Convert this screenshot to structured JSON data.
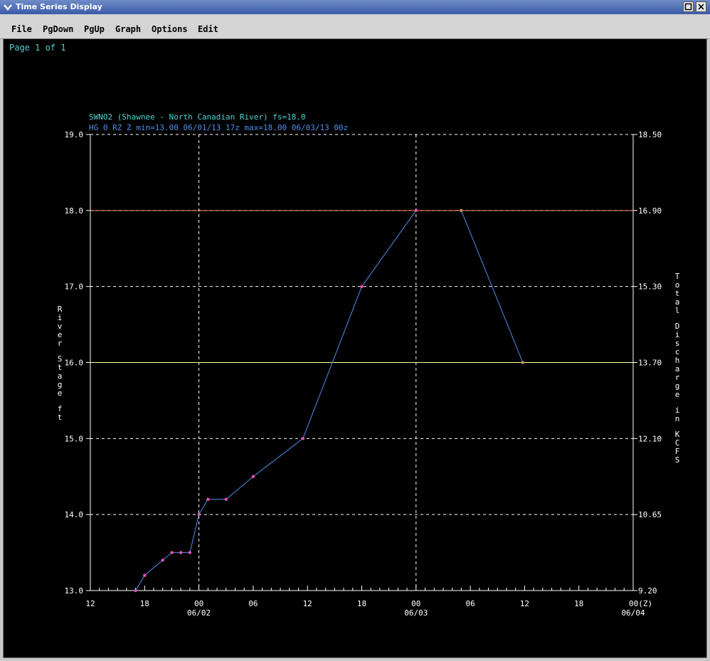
{
  "window": {
    "title": "Time Series Display"
  },
  "menu": [
    "File",
    "PgDown",
    "PgUp",
    "Graph",
    "Options",
    "Edit"
  ],
  "page_info": "Page 1 of 1",
  "colors": {
    "window_bg": "#000000",
    "grid": "#ffffff",
    "series_line": "#4f8fe8",
    "point": "#e84fb8",
    "forecast_point": "#c8904f",
    "flood_stage": "#ff8a6a",
    "action_stage": "#ffff99",
    "title_cyan": "#4fd2d2",
    "title_blue": "#4f8fe8"
  },
  "chart_data": {
    "type": "line",
    "title": "SWNO2 (Shawnee - North Canadian River) fs=18.0",
    "subtitle": "HG 0 RZ Z min=13.00 06/01/13 17z max=18.00 06/03/13 00z",
    "ylabel": "River Stage ft",
    "ylabel_right": "Total Discharge in KCFS",
    "ylim": [
      13.0,
      19.0
    ],
    "yticks": [
      "13.0",
      "14.0",
      "15.0",
      "16.0",
      "17.0",
      "18.0",
      "19.0"
    ],
    "yticks_right": [
      "9.20",
      "10.65",
      "12.10",
      "13.70",
      "15.30",
      "16.90",
      "18.50"
    ],
    "x_unit": "hours",
    "x_range": [
      "06/01 12Z",
      "06/04 00Z"
    ],
    "xticks": [
      {
        "hour": 0,
        "label": "12",
        "date": ""
      },
      {
        "hour": 6,
        "label": "18",
        "date": ""
      },
      {
        "hour": 12,
        "label": "00",
        "date": "06/02"
      },
      {
        "hour": 18,
        "label": "06",
        "date": ""
      },
      {
        "hour": 24,
        "label": "12",
        "date": ""
      },
      {
        "hour": 30,
        "label": "18",
        "date": ""
      },
      {
        "hour": 36,
        "label": "00",
        "date": "06/03"
      },
      {
        "hour": 42,
        "label": "06",
        "date": ""
      },
      {
        "hour": 48,
        "label": "12",
        "date": ""
      },
      {
        "hour": 54,
        "label": "18",
        "date": ""
      },
      {
        "hour": 60,
        "label": "00(Z)",
        "date": "06/04"
      }
    ],
    "flood_stage": 18.0,
    "action_stage": 16.0,
    "series": [
      {
        "points": [
          [
            5,
            13.0
          ],
          [
            6,
            13.2
          ],
          [
            8,
            13.4
          ],
          [
            9,
            13.5
          ],
          [
            10,
            13.5
          ],
          [
            11,
            13.5
          ],
          [
            12,
            14.0
          ],
          [
            13,
            14.2
          ],
          [
            15,
            14.2
          ],
          [
            18,
            14.5
          ],
          [
            23.5,
            15.0
          ],
          [
            30,
            17.0
          ],
          [
            36,
            18.0
          ]
        ]
      },
      {
        "points": [
          [
            41,
            18.0
          ],
          [
            47.8,
            16.0
          ]
        ]
      }
    ]
  }
}
